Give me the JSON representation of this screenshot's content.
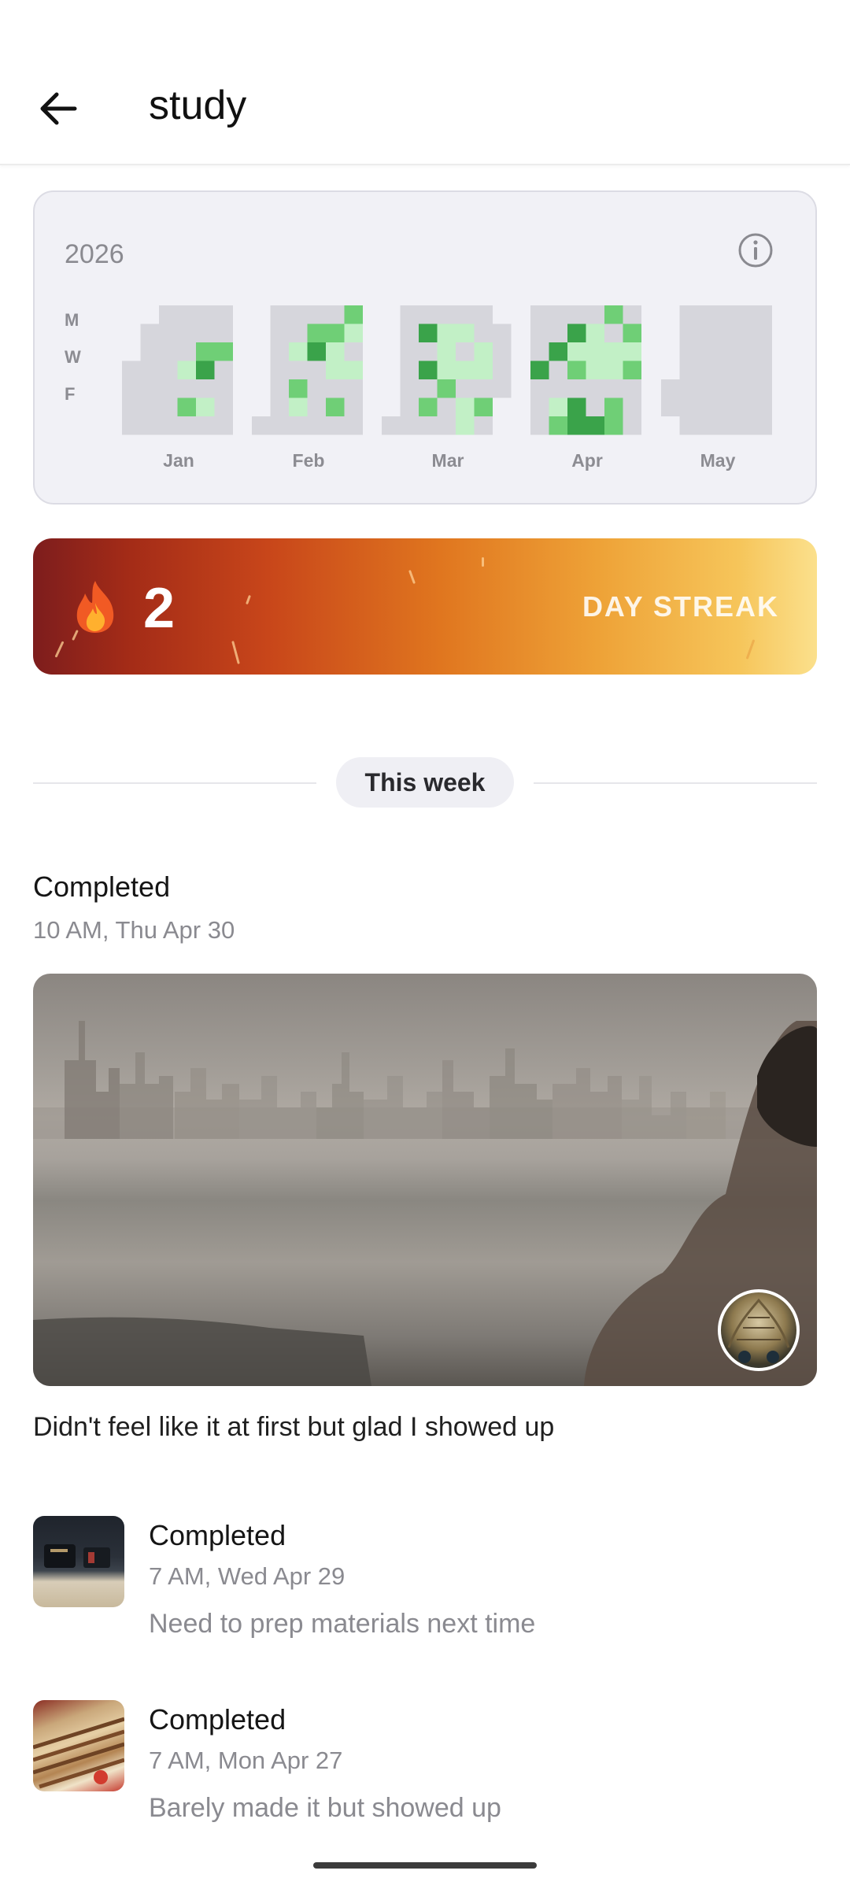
{
  "header": {
    "title": "study"
  },
  "heatmap": {
    "year": "2026",
    "day_labels": [
      "M",
      "W",
      "F"
    ],
    "months": [
      "Jan",
      "Feb",
      "Mar",
      "Apr",
      "May"
    ]
  },
  "streak": {
    "count": "2",
    "label": "DAY STREAK"
  },
  "section": {
    "label": "This week"
  },
  "featured_entry": {
    "status": "Completed",
    "time": "10 AM, Thu Apr 30",
    "note": "Didn't feel like it at first but glad I showed up"
  },
  "entries": [
    {
      "status": "Completed",
      "time": "7 AM, Wed Apr 29",
      "note": "Need to prep materials next time"
    },
    {
      "status": "Completed",
      "time": "7 AM, Mon Apr 27",
      "note": "Barely made it but showed up"
    }
  ],
  "colors": {
    "cell_empty": "#d6d6dc",
    "cell_light": "#c2f0c6",
    "cell_mid": "#6fcf76",
    "cell_dark": "#3aa34a"
  }
}
